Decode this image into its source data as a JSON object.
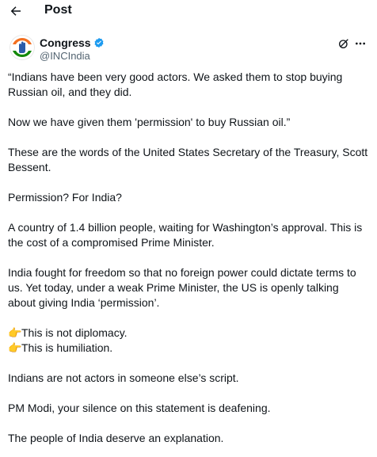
{
  "header": {
    "title": "Post"
  },
  "author": {
    "display_name": "Congress",
    "handle": "@INCIndia"
  },
  "tweet": {
    "p1": "“Indians have been very good actors. We asked them to stop buying Russian oil, and they did.",
    "p2": "Now we have given them 'permission' to buy Russian oil.”",
    "p3": "These are the words of the United States Secretary of the Treasury, Scott Bessent.",
    "p4": "Permission? For India?",
    "p5": "A country of 1.4 billion people, waiting for Washington’s approval. This is the cost of a compromised Prime Minister.",
    "p6": "India fought for freedom so that no foreign power could dictate terms to us. Yet today, under a weak Prime Minister, the US is openly talking about giving India ‘permission’.",
    "emoji": "👉",
    "p7a": "This is not diplomacy.",
    "p7b": "This is humiliation.",
    "p8": "Indians are not actors in someone else’s script.",
    "p9": "PM Modi, your silence on this statement is deafening.",
    "p10": "The people of India deserve an explanation."
  },
  "colors": {
    "text": "#0f1419",
    "secondary": "#536471",
    "verified": "#1d9bf0",
    "brand_orange": "#f37021",
    "brand_green": "#138808"
  },
  "icons": {
    "back": "arrow-left-icon",
    "verified": "verified-badge-icon",
    "grok": "grok-icon",
    "more": "more-icon"
  }
}
